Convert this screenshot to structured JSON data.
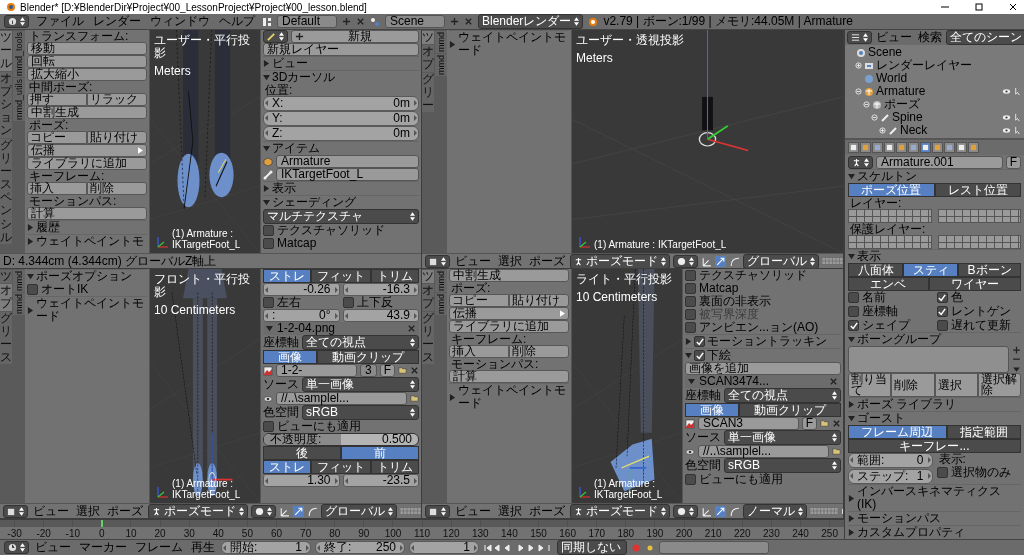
{
  "title_bar": {
    "title": "Blender* [D:¥BlenderDir¥Project¥00_LessonProject¥Project¥00_lesson.blend]"
  },
  "top_header": {
    "menus": [
      "ファイル",
      "レンダー",
      "ウィンドウ",
      "ヘルプ"
    ],
    "screen": "Default",
    "scene": "Scene",
    "engine": "Blenderレンダー",
    "info": "v2.79 | ボーン:1/99 | メモリ:44.05M | Armature"
  },
  "areas": [
    {
      "tabs": [
        {
          "label": "ツール",
          "selected": true
        },
        {
          "label": "オプション",
          "selected": false
        },
        {
          "label": "グリースペンシル",
          "selected": false
        },
        {
          "label": "mmd_tools",
          "selected": false
        },
        {
          "label": "mmd_utils",
          "selected": false
        }
      ],
      "shelf": [
        {
          "kind": "label",
          "text": "トランスフォーム:"
        },
        {
          "kind": "button",
          "label": "移動"
        },
        {
          "kind": "button",
          "label": "回転"
        },
        {
          "kind": "button",
          "label": "拡大縮小"
        },
        {
          "kind": "label",
          "text": "中間ポーズ:"
        },
        {
          "kind": "buttons",
          "labels": [
            "押す",
            "リラック"
          ]
        },
        {
          "kind": "button",
          "label": "中割生成"
        },
        {
          "kind": "label",
          "text": "ポーズ:"
        },
        {
          "kind": "buttons",
          "labels": [
            "コピー",
            "貼り付け"
          ]
        },
        {
          "kind": "menu_button",
          "label": "伝播"
        },
        {
          "kind": "button",
          "label": "ライブラリに追加"
        },
        {
          "kind": "label",
          "text": "キーフレーム:"
        },
        {
          "kind": "buttons",
          "labels": [
            "挿入",
            "削除"
          ]
        },
        {
          "kind": "label",
          "text": "モーションパス:"
        },
        {
          "kind": "button",
          "label": "計算"
        },
        {
          "kind": "section",
          "label": "履歴",
          "expanded": false
        },
        {
          "kind": "section",
          "label": "ウェイトペイントモ",
          "expanded": false
        }
      ],
      "viewport": {
        "kind": "feet",
        "lines": [
          "ユーザー・平行投影",
          "Meters"
        ],
        "footer": "(1) Armature : IKTargetFoot_L"
      },
      "npanel": [
        {
          "kind": "new",
          "label": "新規"
        },
        {
          "kind": "button",
          "label": "新規レイヤー"
        },
        {
          "kind": "section",
          "label": "ビュー",
          "expanded": false
        },
        {
          "kind": "section",
          "label": "3Dカーソル",
          "expanded": true
        },
        {
          "kind": "label",
          "text": "位置:"
        },
        {
          "kind": "field",
          "label": "X:",
          "value": "0m"
        },
        {
          "kind": "field",
          "label": "Y:",
          "value": "0m"
        },
        {
          "kind": "field",
          "label": "Z:",
          "value": "0m"
        },
        {
          "kind": "section",
          "label": "アイテム",
          "expanded": true
        },
        {
          "kind": "object_field",
          "value": "Armature"
        },
        {
          "kind": "bone_field",
          "value": "IKTargetFoot_L"
        },
        {
          "kind": "section",
          "label": "表示",
          "expanded": false
        },
        {
          "kind": "section",
          "label": "シェーディング",
          "expanded": true
        },
        {
          "kind": "dropdown",
          "value": "マルチテクスチャ"
        },
        {
          "kind": "checkbox",
          "label": "テクスチャソリッド",
          "checked": false
        },
        {
          "kind": "checkbox",
          "label": "Matcap",
          "checked": false
        }
      ],
      "bar": {
        "kind": "status",
        "text": "D: 4.344cm (4.344cm) グローバルZ軸上"
      }
    },
    {
      "tabs": [
        {
          "label": "ツ",
          "selected": true
        },
        {
          "label": "オプ",
          "selected": false
        },
        {
          "label": "グリー",
          "selected": false
        },
        {
          "label": "mmd",
          "selected": false
        },
        {
          "label": "mmd",
          "selected": false
        }
      ],
      "shelf": [
        {
          "kind": "section",
          "label": "ウェイトペイントモード",
          "expanded": false
        }
      ],
      "viewport": {
        "kind": "overview",
        "lines": [
          "ユーザー・透視投影",
          "Meters"
        ],
        "footer": "(1) Armature : IKTargetFoot_L"
      },
      "bar": {
        "kind": "header",
        "menus": [
          "ビュー",
          "選択",
          "ポーズ"
        ],
        "mode": "ポーズモード",
        "orientation": "グローバル"
      }
    },
    {
      "tabs": [
        {
          "label": "ツ",
          "selected": false
        },
        {
          "label": "オプ",
          "selected": true
        },
        {
          "label": "グリース",
          "selected": false
        },
        {
          "label": "mmd",
          "selected": false
        },
        {
          "label": "mmd",
          "selected": false
        }
      ],
      "shelf": [
        {
          "kind": "section",
          "label": "ポーズオプション",
          "expanded": true
        },
        {
          "kind": "checkbox",
          "label": "オートIK",
          "checked": false
        },
        {
          "kind": "section",
          "label": "ウェイトペイントモード",
          "expanded": false
        }
      ],
      "viewport": {
        "kind": "front",
        "lines": [
          "フロント・平行投影",
          "10 Centimeters"
        ],
        "footer": "(1) Armature : IKTargetFoot_L"
      },
      "npanel": [
        {
          "kind": "toggles",
          "items": [
            {
              "label": "ストレ",
              "selected": true
            },
            {
              "label": "フィット",
              "selected": false
            },
            {
              "label": "トリム",
              "selected": false
            }
          ]
        },
        {
          "kind": "fields",
          "items": [
            {
              "value": "-0.26"
            },
            {
              "value": "-16.3"
            }
          ]
        },
        {
          "kind": "checks",
          "items": [
            {
              "label": "左右",
              "checked": false
            },
            {
              "label": "上下反",
              "checked": false
            }
          ]
        },
        {
          "kind": "fields",
          "items": [
            {
              "label": ":",
              "value": "0°"
            },
            {
              "value": "43.9"
            }
          ]
        },
        {
          "kind": "image_header",
          "label": "1-2-04.png",
          "expanded": true
        },
        {
          "kind": "dropdown",
          "label": "座標軸",
          "value": "全ての視点"
        },
        {
          "kind": "toggles",
          "items": [
            {
              "label": "画像",
              "selected": true
            },
            {
              "label": "動画クリップ",
              "selected": false
            }
          ]
        },
        {
          "kind": "image_select",
          "value": "1-2-",
          "count": "3",
          "button": "F"
        },
        {
          "kind": "dropdown",
          "label": "ソース",
          "value": "単一画像"
        },
        {
          "kind": "file",
          "value": "//..\\samplel..."
        },
        {
          "kind": "dropdown",
          "label": "色空間",
          "value": "sRGB"
        },
        {
          "kind": "checkbox",
          "label": "ビューにも適用",
          "checked": false
        },
        {
          "kind": "slider",
          "label": "不透明度:",
          "value": "0.500",
          "level": 0.5
        },
        {
          "kind": "toggles",
          "items": [
            {
              "label": "後",
              "selected": false
            },
            {
              "label": "前",
              "selected": true
            }
          ]
        },
        {
          "kind": "toggles",
          "items": [
            {
              "label": "ストレ",
              "selected": true
            },
            {
              "label": "フィット",
              "selected": false
            },
            {
              "label": "トリム",
              "selected": false
            }
          ]
        },
        {
          "kind": "fields",
          "items": [
            {
              "value": "1.30"
            },
            {
              "value": "-23.5"
            }
          ]
        }
      ],
      "bar": {
        "kind": "header",
        "menus": [
          "ビュー",
          "選択",
          "ポーズ"
        ],
        "mode": "ポーズモード",
        "orientation": "グローバル"
      }
    },
    {
      "tabs": [
        {
          "label": "ツ",
          "selected": true
        },
        {
          "label": "オプ",
          "selected": false
        },
        {
          "label": "グリース",
          "selected": false
        },
        {
          "label": "mmd",
          "selected": false
        },
        {
          "label": "mmd",
          "selected": false
        }
      ],
      "shelf": [
        {
          "kind": "button",
          "label": "中割生成"
        },
        {
          "kind": "label",
          "text": "ポーズ:"
        },
        {
          "kind": "buttons",
          "labels": [
            "コピー",
            "貼り付け"
          ]
        },
        {
          "kind": "menu_button",
          "label": "伝播"
        },
        {
          "kind": "button",
          "label": "ライブラリに追加"
        },
        {
          "kind": "label",
          "text": "キーフレーム:"
        },
        {
          "kind": "buttons",
          "labels": [
            "挿入",
            "削除"
          ]
        },
        {
          "kind": "label",
          "text": "モーションパス:"
        },
        {
          "kind": "button",
          "label": "計算"
        },
        {
          "kind": "section",
          "label": "ウェイトペイントモード",
          "expanded": false
        }
      ],
      "viewport": {
        "kind": "side",
        "lines": [
          "ライト・平行投影",
          "10 Centimeters"
        ],
        "footer": "(1) Armature : IKTargetFoot_L"
      },
      "npanel": [
        {
          "kind": "checkbox",
          "label": "テクスチャソリッド",
          "checked": false
        },
        {
          "kind": "checkbox",
          "label": "Matcap",
          "checked": false
        },
        {
          "kind": "checkbox",
          "label": "裏面の非表示",
          "checked": false
        },
        {
          "kind": "checkbox",
          "label": "被写界深度",
          "checked": false,
          "disabled": true
        },
        {
          "kind": "checkbox",
          "label": "アンビエン...ョン(AO)",
          "checked": false
        },
        {
          "kind": "section",
          "label": "モーショントラッキン",
          "expanded": false,
          "checked": true
        },
        {
          "kind": "section",
          "label": "下絵",
          "expanded": true,
          "checked": true
        },
        {
          "kind": "button",
          "label": "画像を追加"
        },
        {
          "kind": "image_header",
          "label": "SCAN3474...",
          "expanded": true
        },
        {
          "kind": "dropdown",
          "label": "座標軸",
          "value": "全ての視点"
        },
        {
          "kind": "toggles",
          "items": [
            {
              "label": "画像",
              "selected": true
            },
            {
              "label": "動画クリップ",
              "selected": false
            }
          ]
        },
        {
          "kind": "image_select",
          "value": "SCAN3",
          "button": "F"
        },
        {
          "kind": "dropdown",
          "label": "ソース",
          "value": "単一画像"
        },
        {
          "kind": "file",
          "value": "//..\\samplel..."
        },
        {
          "kind": "dropdown",
          "label": "色空間",
          "value": "sRGB"
        },
        {
          "kind": "checkbox",
          "label": "ビューにも適用",
          "checked": false
        }
      ],
      "bar": {
        "kind": "header",
        "menus": [
          "ビュー",
          "選択",
          "ポーズ"
        ],
        "mode": "ポーズモード",
        "orientation": "ノーマル"
      }
    }
  ],
  "properties": {
    "outliner": {
      "menus": [
        "ビュー",
        "検索"
      ],
      "scope": "全てのシーン",
      "tree": [
        {
          "kind": "scene",
          "label": "Scene",
          "children": [
            {
              "kind": "layer",
              "label": "レンダーレイヤー",
              "expanded": false
            },
            {
              "kind": "world",
              "label": "World"
            },
            {
              "kind": "object",
              "label": "Armature",
              "expanded": true,
              "children": [
                {
                  "kind": "pose",
                  "label": "ポーズ",
                  "expanded": true,
                  "children": [
                    {
                      "kind": "bone",
                      "label": "Spine",
                      "expanded": true,
                      "children": [
                        {
                          "kind": "bone",
                          "label": "Neck",
                          "expanded": false
                        }
                      ]
                    }
                  ]
                }
              ]
            }
          ]
        }
      ]
    },
    "context_tabs": [
      {
        "selected": false
      },
      {
        "selected": false
      },
      {
        "selected": false
      },
      {
        "selected": false
      },
      {
        "selected": false
      },
      {
        "selected": false
      },
      {
        "selected": true
      },
      {
        "selected": false
      },
      {
        "selected": false
      },
      {
        "selected": false
      },
      {
        "selected": false
      }
    ],
    "rows": [
      {
        "kind": "name_row",
        "value": "Armature.001",
        "button": "F"
      },
      {
        "kind": "section",
        "label": "スケルトン",
        "expanded": true
      },
      {
        "kind": "toggles",
        "items": [
          {
            "label": "ポーズ位置",
            "selected": true
          },
          {
            "label": "レスト位置",
            "selected": false
          }
        ]
      },
      {
        "kind": "label",
        "text": "レイヤー:"
      },
      {
        "kind": "layers"
      },
      {
        "kind": "label",
        "text": "保護レイヤー:"
      },
      {
        "kind": "layers"
      },
      {
        "kind": "section",
        "label": "表示",
        "expanded": true
      },
      {
        "kind": "toggles",
        "items": [
          {
            "label": "八面体",
            "selected": false
          },
          {
            "label": "スティ",
            "selected": true
          },
          {
            "label": "Bボーン",
            "selected": false
          },
          {
            "label": "エンベ",
            "selected": false
          },
          {
            "label": "ワイヤー",
            "selected": false
          }
        ]
      },
      {
        "kind": "checks",
        "items": [
          {
            "label": "名前",
            "checked": false
          },
          {
            "label": "色",
            "checked": true
          },
          {
            "label": "座標軸",
            "checked": false
          },
          {
            "label": "レントゲン",
            "checked": true
          },
          {
            "label": "シェイプ",
            "checked": true
          },
          {
            "label": "遅れて更新",
            "checked": false
          }
        ]
      },
      {
        "kind": "section",
        "label": "ボーングループ",
        "expanded": true
      },
      {
        "kind": "list"
      },
      {
        "kind": "buttons",
        "labels": [
          "割り当て",
          "削除",
          "選択",
          "選択解除"
        ]
      },
      {
        "kind": "section",
        "label": "ポーズ ライブラリ",
        "expanded": false
      },
      {
        "kind": "section",
        "label": "ゴースト",
        "expanded": true
      },
      {
        "kind": "toggles",
        "items": [
          {
            "label": "フレーム周辺",
            "selected": true
          },
          {
            "label": "指定範囲",
            "selected": false
          },
          {
            "label": "キーフレー...",
            "selected": false
          }
        ]
      },
      {
        "kind": "columns",
        "left": [
          {
            "kind": "field",
            "label": "範囲:",
            "value": "0"
          },
          {
            "kind": "field",
            "label": "ステップ:",
            "value": "1"
          }
        ],
        "right": [
          {
            "kind": "label",
            "text": "表示:"
          },
          {
            "kind": "checkbox",
            "label": "選択物のみ",
            "checked": false
          }
        ]
      },
      {
        "kind": "section",
        "label": "インバースキネマティクス (IK)",
        "expanded": false
      },
      {
        "kind": "section",
        "label": "モーションパス",
        "expanded": false
      },
      {
        "kind": "section",
        "label": "カスタムプロパティ",
        "expanded": false
      }
    ]
  },
  "timeline": {
    "labels": [
      {
        "text": "-30",
        "current": false
      },
      {
        "text": "-20",
        "current": false
      },
      {
        "text": "-10",
        "current": false
      },
      {
        "text": "0",
        "current": true
      },
      {
        "text": "10",
        "current": false
      },
      {
        "text": "20",
        "current": false
      },
      {
        "text": "30",
        "current": false
      },
      {
        "text": "40",
        "current": false
      },
      {
        "text": "50",
        "current": false
      },
      {
        "text": "60",
        "current": false
      },
      {
        "text": "70",
        "current": false
      },
      {
        "text": "80",
        "current": false
      },
      {
        "text": "90",
        "current": false
      },
      {
        "text": "100",
        "current": false
      },
      {
        "text": "110",
        "current": false
      },
      {
        "text": "120",
        "current": false
      },
      {
        "text": "130",
        "current": false
      },
      {
        "text": "140",
        "current": false
      },
      {
        "text": "150",
        "current": false
      },
      {
        "text": "160",
        "current": false
      },
      {
        "text": "170",
        "current": false
      },
      {
        "text": "180",
        "current": false
      },
      {
        "text": "190",
        "current": false
      },
      {
        "text": "200",
        "current": false
      },
      {
        "text": "210",
        "current": false
      },
      {
        "text": "220",
        "current": false
      },
      {
        "text": "230",
        "current": false
      },
      {
        "text": "240",
        "current": false
      },
      {
        "text": "250",
        "current": false
      }
    ]
  },
  "bottom_header": {
    "menus": [
      "ビュー",
      "マーカー",
      "フレーム",
      "再生"
    ],
    "start_label": "開始:",
    "start": "1",
    "end_label": "終了:",
    "end": "250",
    "frame": "1",
    "sync": "同期しない"
  }
}
